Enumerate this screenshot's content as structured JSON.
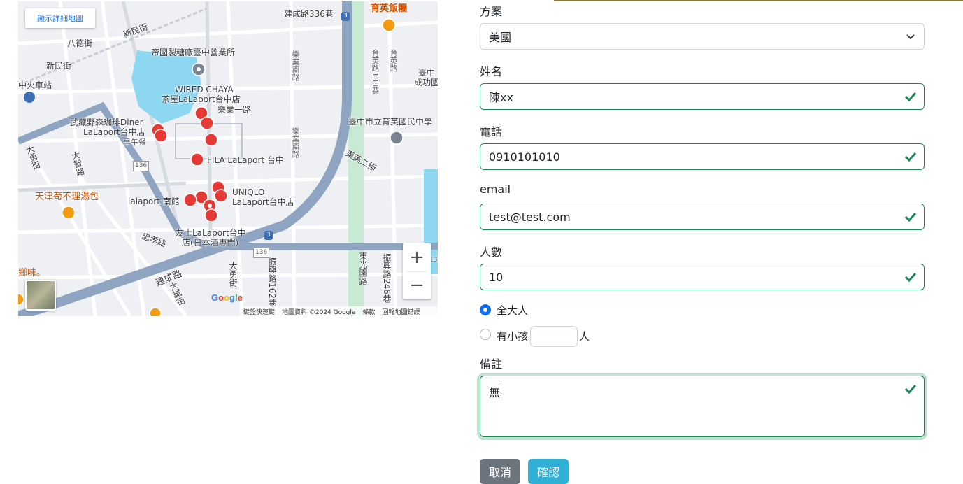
{
  "map": {
    "detail_link": "顯示詳細地圖",
    "labels": {
      "jiancheng336": "建成路336巷",
      "yuying_rice": "育英飯糰",
      "xinmin_st": "新民街",
      "bade_st": "八德街",
      "xinmin_st2": "新民街",
      "taichung_station": "中火車站",
      "sugar_factory": "帝國製糖廠臺中營業所",
      "wired_chaya_1": "WIRED CHAYA",
      "wired_chaya_2": "茶屋LaLaport台中店",
      "leye_rd": "樂業一路",
      "musashino_1": "武藏野森珈琲Diner",
      "musashino_2": "LaLaport台中店",
      "musashino_3": "早午餐",
      "fila": "FILA LaLaport 台中",
      "uniqlo_1": "UNIQLO",
      "uniqlo_2": "LaLaport台中店",
      "lalaport_south": "lalaport 南館",
      "tianjin_1": "天津苟不理湯包",
      "tomoshi_1": "友士LaLaport台中",
      "tomoshi_2": "店(日本酒専門)",
      "zhongxiao_rd": "忠孝路",
      "jiancheng_rd": "建成路",
      "dayuan_st": "大勇街",
      "dazhi_rd": "大智路",
      "dayong_st": "大勇街",
      "dayuan_st2": "大誠街",
      "zhenxing_162": "振興路162巷",
      "dongguang_garden": "東光園路",
      "zhenxing_246": "振興路246巷",
      "dongying_2": "東英二街",
      "yuying_middle": "臺中市立育英國民中學",
      "taichung_cg": "臺中",
      "taichung_cg2": "成功國",
      "leye_south": "樂業南路",
      "leye_south2": "樂業南路",
      "yuying_188": "育英路188巷",
      "yuying_rd": "育英路",
      "xiangwei": "鄉味。",
      "road136a": "136",
      "road136b": "136",
      "road3a": "3",
      "road3b": "3",
      "road13": "13"
    },
    "google": "Google",
    "footer": [
      "鍵盤快速鍵",
      "地圖資料 ©2024 Google",
      "條款",
      "回報地圖錯誤"
    ]
  },
  "form": {
    "plan_label": "方案",
    "plan_value": "美國",
    "name_label": "姓名",
    "name_value": "陳xx",
    "phone_label": "電話",
    "phone_value": "0910101010",
    "email_label": "email",
    "email_value": "test@test.com",
    "people_label": "人數",
    "people_value": "10",
    "radio_adults": "全大人",
    "radio_kids": "有小孩",
    "kids_unit": "人",
    "note_label": "備註",
    "note_value": "無",
    "cancel": "取消",
    "confirm": "確認"
  },
  "colors": {
    "valid": "#198754",
    "primary": "#0d6efd",
    "cancel": "#6c757d",
    "confirm": "#31b0d5",
    "map_water": "#8dd7f0",
    "map_highway": "#8ea4c0",
    "map_park": "#c8ead4",
    "poi_red": "#e53935",
    "poi_orange": "#f39c12"
  }
}
